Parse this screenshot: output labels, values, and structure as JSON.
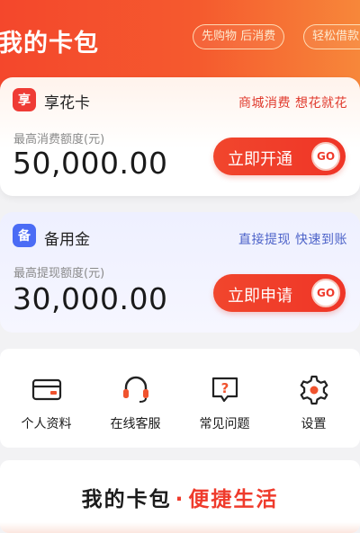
{
  "header": {
    "title": "我的卡包",
    "tags": [
      "先购物 后消费",
      "轻松借款"
    ]
  },
  "cards": [
    {
      "icon_char": "享",
      "icon": "xiang-badge-icon",
      "name": "享花卡",
      "slogan": "商城消费 想花就花",
      "sub_label": "最高消费额度(元)",
      "amount": "50,000.00",
      "button_label": "立即开通",
      "go_label": "GO"
    },
    {
      "icon_char": "备",
      "icon": "bei-badge-icon",
      "name": "备用金",
      "slogan": "直接提现 快速到账",
      "sub_label": "最高提现额度(元)",
      "amount": "30,000.00",
      "button_label": "立即申请",
      "go_label": "GO"
    }
  ],
  "quick_menu": [
    {
      "label": "个人资料",
      "icon": "id-card-icon"
    },
    {
      "label": "在线客服",
      "icon": "headset-icon"
    },
    {
      "label": "常见问题",
      "icon": "question-bubble-icon"
    },
    {
      "label": "设置",
      "icon": "gear-icon"
    }
  ],
  "footer": {
    "text_a": "我的卡包",
    "separator": "·",
    "text_b": "便捷生活"
  },
  "colors": {
    "brand_red": "#ef3b2c",
    "accent_blue": "#4b6cf5"
  }
}
